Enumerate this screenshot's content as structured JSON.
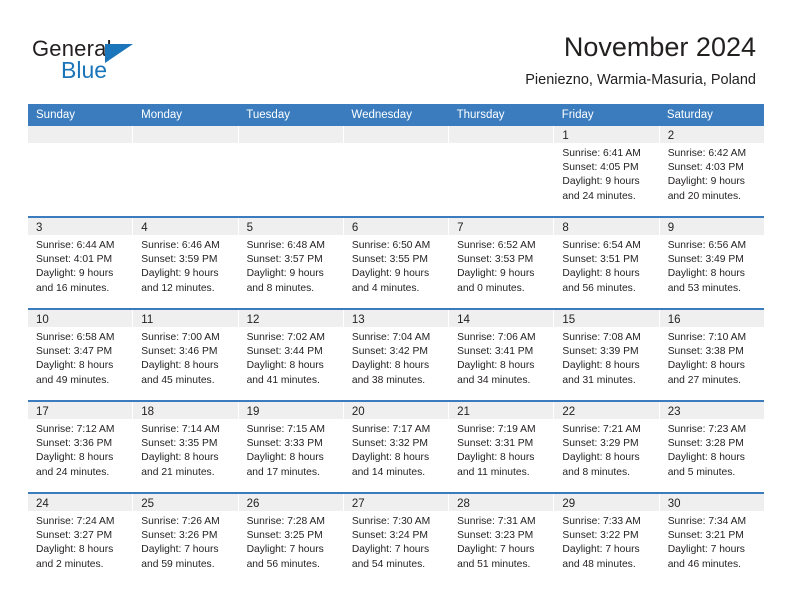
{
  "logo": {
    "word_top": "General",
    "word_bottom": "Blue",
    "triangle_color": "#1b75bb",
    "icon": "general-blue-logo"
  },
  "header": {
    "title": "November 2024",
    "subtitle": "Pieniezno, Warmia-Masuria, Poland"
  },
  "colors": {
    "header_band": "#3a7cbe",
    "date_strip": "#efefef",
    "text": "#221f1f",
    "brand_blue": "#1b75bb"
  },
  "weekdays": [
    "Sunday",
    "Monday",
    "Tuesday",
    "Wednesday",
    "Thursday",
    "Friday",
    "Saturday"
  ],
  "weeks": [
    [
      {
        "day": ""
      },
      {
        "day": ""
      },
      {
        "day": ""
      },
      {
        "day": ""
      },
      {
        "day": ""
      },
      {
        "day": "1",
        "sunrise": "Sunrise: 6:41 AM",
        "sunset": "Sunset: 4:05 PM",
        "daylight1": "Daylight: 9 hours",
        "daylight2": "and 24 minutes."
      },
      {
        "day": "2",
        "sunrise": "Sunrise: 6:42 AM",
        "sunset": "Sunset: 4:03 PM",
        "daylight1": "Daylight: 9 hours",
        "daylight2": "and 20 minutes."
      }
    ],
    [
      {
        "day": "3",
        "sunrise": "Sunrise: 6:44 AM",
        "sunset": "Sunset: 4:01 PM",
        "daylight1": "Daylight: 9 hours",
        "daylight2": "and 16 minutes."
      },
      {
        "day": "4",
        "sunrise": "Sunrise: 6:46 AM",
        "sunset": "Sunset: 3:59 PM",
        "daylight1": "Daylight: 9 hours",
        "daylight2": "and 12 minutes."
      },
      {
        "day": "5",
        "sunrise": "Sunrise: 6:48 AM",
        "sunset": "Sunset: 3:57 PM",
        "daylight1": "Daylight: 9 hours",
        "daylight2": "and 8 minutes."
      },
      {
        "day": "6",
        "sunrise": "Sunrise: 6:50 AM",
        "sunset": "Sunset: 3:55 PM",
        "daylight1": "Daylight: 9 hours",
        "daylight2": "and 4 minutes."
      },
      {
        "day": "7",
        "sunrise": "Sunrise: 6:52 AM",
        "sunset": "Sunset: 3:53 PM",
        "daylight1": "Daylight: 9 hours",
        "daylight2": "and 0 minutes."
      },
      {
        "day": "8",
        "sunrise": "Sunrise: 6:54 AM",
        "sunset": "Sunset: 3:51 PM",
        "daylight1": "Daylight: 8 hours",
        "daylight2": "and 56 minutes."
      },
      {
        "day": "9",
        "sunrise": "Sunrise: 6:56 AM",
        "sunset": "Sunset: 3:49 PM",
        "daylight1": "Daylight: 8 hours",
        "daylight2": "and 53 minutes."
      }
    ],
    [
      {
        "day": "10",
        "sunrise": "Sunrise: 6:58 AM",
        "sunset": "Sunset: 3:47 PM",
        "daylight1": "Daylight: 8 hours",
        "daylight2": "and 49 minutes."
      },
      {
        "day": "11",
        "sunrise": "Sunrise: 7:00 AM",
        "sunset": "Sunset: 3:46 PM",
        "daylight1": "Daylight: 8 hours",
        "daylight2": "and 45 minutes."
      },
      {
        "day": "12",
        "sunrise": "Sunrise: 7:02 AM",
        "sunset": "Sunset: 3:44 PM",
        "daylight1": "Daylight: 8 hours",
        "daylight2": "and 41 minutes."
      },
      {
        "day": "13",
        "sunrise": "Sunrise: 7:04 AM",
        "sunset": "Sunset: 3:42 PM",
        "daylight1": "Daylight: 8 hours",
        "daylight2": "and 38 minutes."
      },
      {
        "day": "14",
        "sunrise": "Sunrise: 7:06 AM",
        "sunset": "Sunset: 3:41 PM",
        "daylight1": "Daylight: 8 hours",
        "daylight2": "and 34 minutes."
      },
      {
        "day": "15",
        "sunrise": "Sunrise: 7:08 AM",
        "sunset": "Sunset: 3:39 PM",
        "daylight1": "Daylight: 8 hours",
        "daylight2": "and 31 minutes."
      },
      {
        "day": "16",
        "sunrise": "Sunrise: 7:10 AM",
        "sunset": "Sunset: 3:38 PM",
        "daylight1": "Daylight: 8 hours",
        "daylight2": "and 27 minutes."
      }
    ],
    [
      {
        "day": "17",
        "sunrise": "Sunrise: 7:12 AM",
        "sunset": "Sunset: 3:36 PM",
        "daylight1": "Daylight: 8 hours",
        "daylight2": "and 24 minutes."
      },
      {
        "day": "18",
        "sunrise": "Sunrise: 7:14 AM",
        "sunset": "Sunset: 3:35 PM",
        "daylight1": "Daylight: 8 hours",
        "daylight2": "and 21 minutes."
      },
      {
        "day": "19",
        "sunrise": "Sunrise: 7:15 AM",
        "sunset": "Sunset: 3:33 PM",
        "daylight1": "Daylight: 8 hours",
        "daylight2": "and 17 minutes."
      },
      {
        "day": "20",
        "sunrise": "Sunrise: 7:17 AM",
        "sunset": "Sunset: 3:32 PM",
        "daylight1": "Daylight: 8 hours",
        "daylight2": "and 14 minutes."
      },
      {
        "day": "21",
        "sunrise": "Sunrise: 7:19 AM",
        "sunset": "Sunset: 3:31 PM",
        "daylight1": "Daylight: 8 hours",
        "daylight2": "and 11 minutes."
      },
      {
        "day": "22",
        "sunrise": "Sunrise: 7:21 AM",
        "sunset": "Sunset: 3:29 PM",
        "daylight1": "Daylight: 8 hours",
        "daylight2": "and 8 minutes."
      },
      {
        "day": "23",
        "sunrise": "Sunrise: 7:23 AM",
        "sunset": "Sunset: 3:28 PM",
        "daylight1": "Daylight: 8 hours",
        "daylight2": "and 5 minutes."
      }
    ],
    [
      {
        "day": "24",
        "sunrise": "Sunrise: 7:24 AM",
        "sunset": "Sunset: 3:27 PM",
        "daylight1": "Daylight: 8 hours",
        "daylight2": "and 2 minutes."
      },
      {
        "day": "25",
        "sunrise": "Sunrise: 7:26 AM",
        "sunset": "Sunset: 3:26 PM",
        "daylight1": "Daylight: 7 hours",
        "daylight2": "and 59 minutes."
      },
      {
        "day": "26",
        "sunrise": "Sunrise: 7:28 AM",
        "sunset": "Sunset: 3:25 PM",
        "daylight1": "Daylight: 7 hours",
        "daylight2": "and 56 minutes."
      },
      {
        "day": "27",
        "sunrise": "Sunrise: 7:30 AM",
        "sunset": "Sunset: 3:24 PM",
        "daylight1": "Daylight: 7 hours",
        "daylight2": "and 54 minutes."
      },
      {
        "day": "28",
        "sunrise": "Sunrise: 7:31 AM",
        "sunset": "Sunset: 3:23 PM",
        "daylight1": "Daylight: 7 hours",
        "daylight2": "and 51 minutes."
      },
      {
        "day": "29",
        "sunrise": "Sunrise: 7:33 AM",
        "sunset": "Sunset: 3:22 PM",
        "daylight1": "Daylight: 7 hours",
        "daylight2": "and 48 minutes."
      },
      {
        "day": "30",
        "sunrise": "Sunrise: 7:34 AM",
        "sunset": "Sunset: 3:21 PM",
        "daylight1": "Daylight: 7 hours",
        "daylight2": "and 46 minutes."
      }
    ]
  ]
}
